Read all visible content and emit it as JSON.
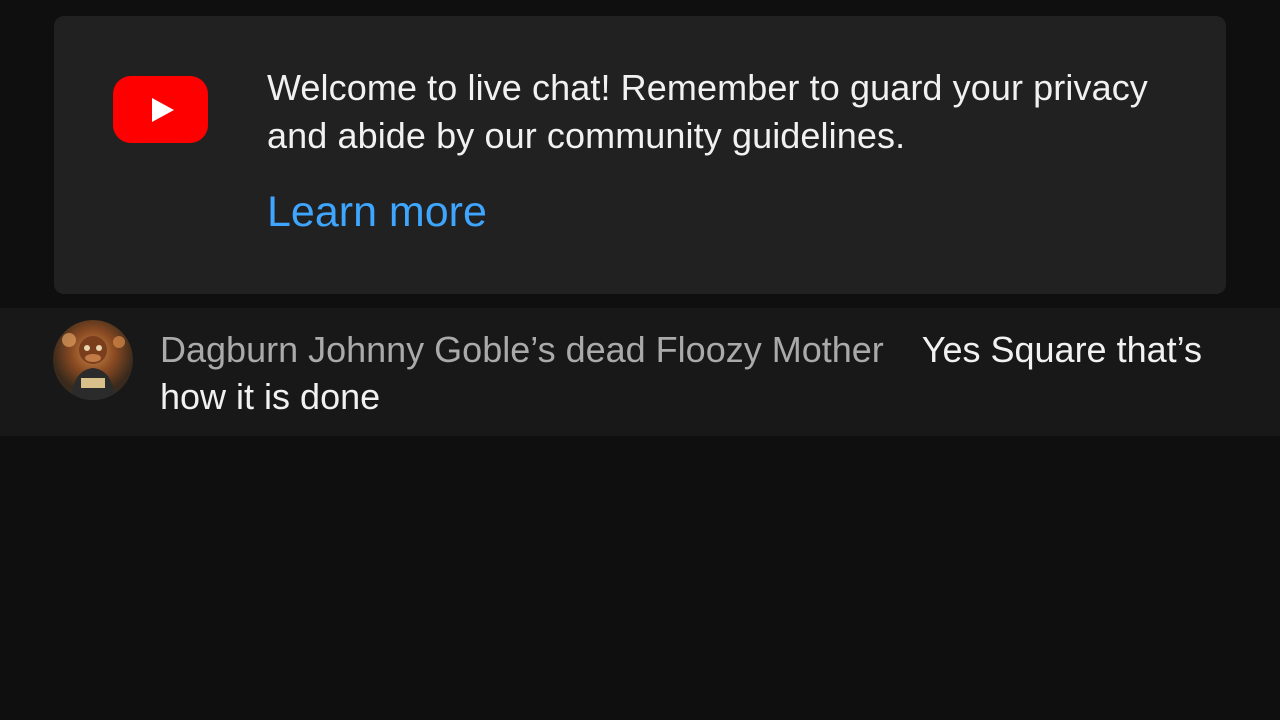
{
  "welcome": {
    "logo_icon": "youtube-logo-icon",
    "message": "Welcome to live chat! Remember to guard your privacy and abide by our community guidelines.",
    "learn_more": "Learn more"
  },
  "messages": [
    {
      "avatar_icon": "user-avatar",
      "author": "Dagburn Johnny Goble’s dead Floozy Mother",
      "text": "Yes Square that’s how it is done"
    }
  ],
  "colors": {
    "background": "#0f0f0f",
    "card": "#212121",
    "message_row": "#181818",
    "link": "#3ea6ff",
    "brand_red": "#ff0000",
    "author": "#aaaaaa",
    "text": "#f1f1f1"
  }
}
